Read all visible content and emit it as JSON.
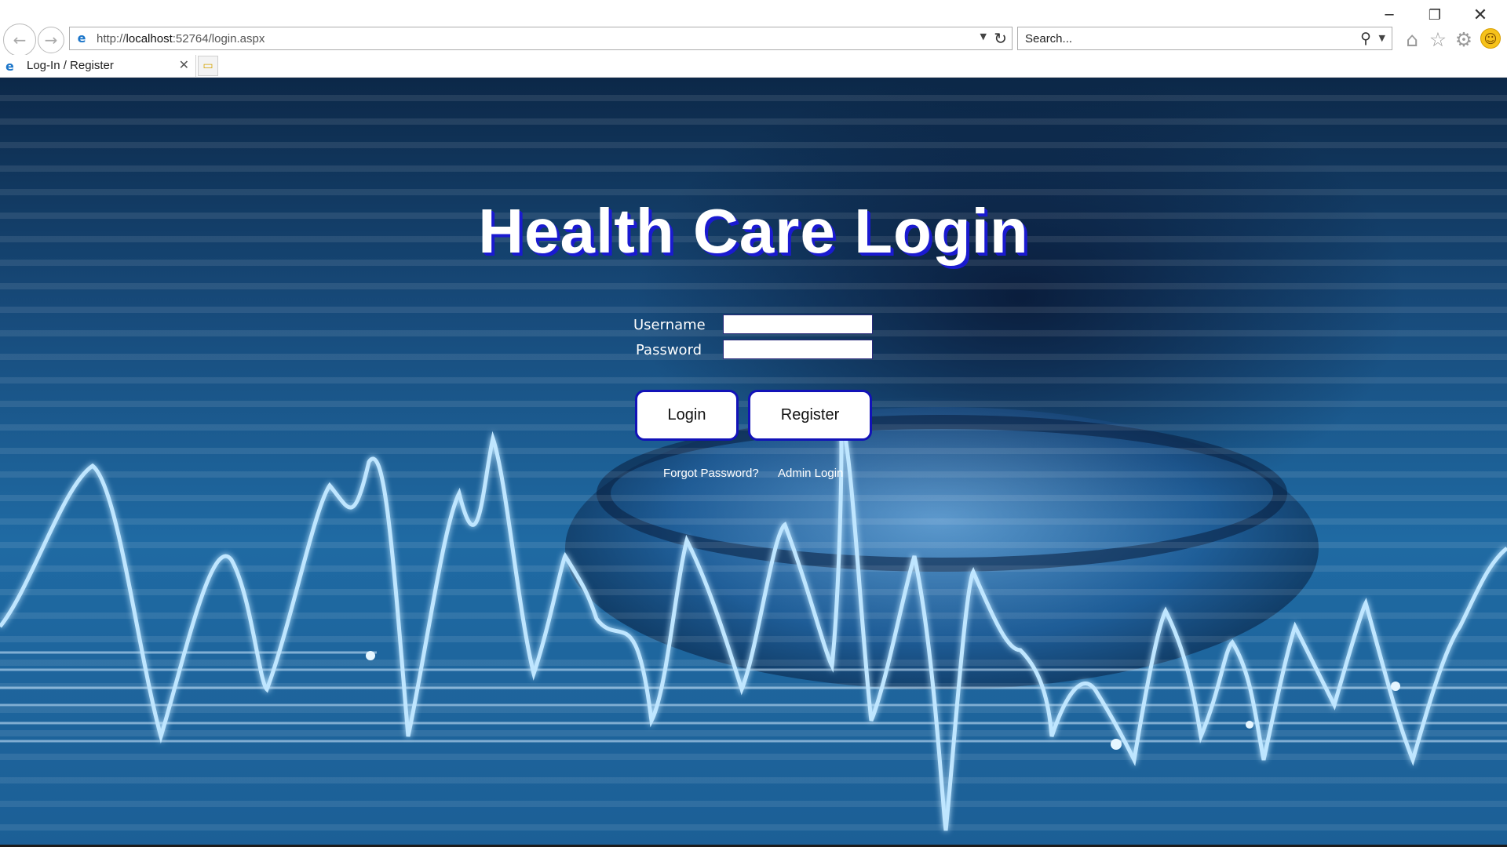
{
  "window": {
    "minimize_glyph": "─",
    "restore_glyph": "❐",
    "close_glyph": "✕"
  },
  "toolbar": {
    "back_glyph": "←",
    "forward_glyph": "→",
    "address": {
      "scheme": "http://",
      "host": "localhost",
      "rest": ":52764/login.aspx"
    },
    "search_placeholder": "Search...",
    "icons": [
      "home-icon",
      "star-icon",
      "gear-icon",
      "smiley-icon"
    ]
  },
  "tabs": [
    {
      "title": "Log-In / Register",
      "active": true
    }
  ],
  "page": {
    "title": "Health Care Login",
    "form": {
      "username_label": "Username",
      "password_label": "Password",
      "username_value": "",
      "password_value": ""
    },
    "buttons": {
      "login": "Login",
      "register": "Register"
    },
    "links": {
      "forgot": "Forgot Password?",
      "admin": "Admin Login"
    }
  },
  "colors": {
    "title_shadow": "#1a1ad0",
    "button_border": "#1212b8",
    "background_primary": "#1f6aa3"
  }
}
